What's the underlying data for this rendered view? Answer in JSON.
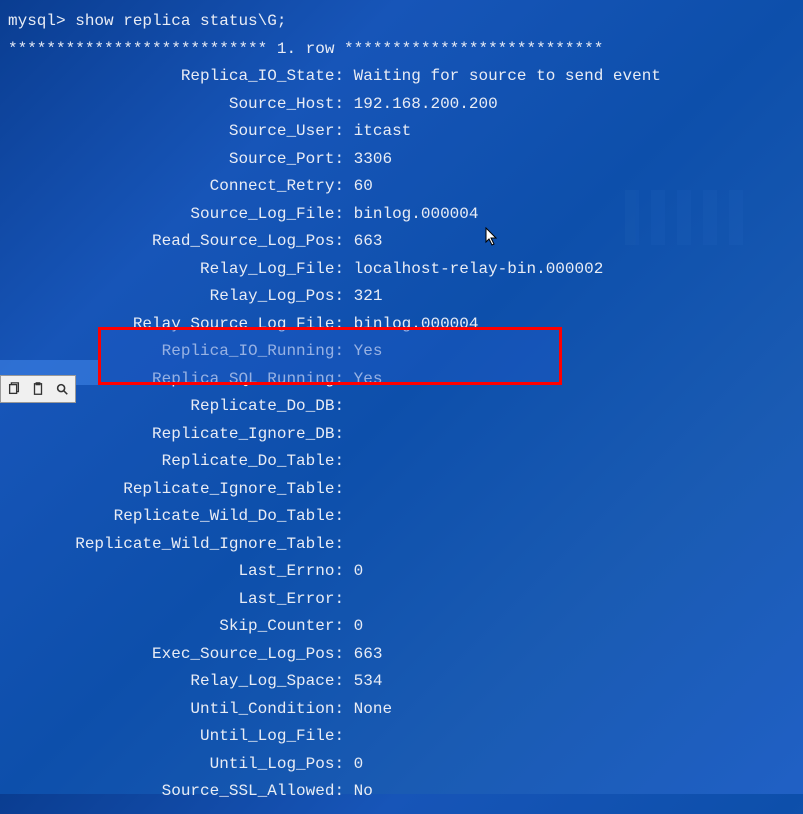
{
  "prompt": "mysql> ",
  "command": "show replica status\\G;",
  "row_separator": "*************************** 1. row ***************************",
  "fields": [
    {
      "label": "Replica_IO_State",
      "value": "Waiting for source to send event"
    },
    {
      "label": "Source_Host",
      "value": "192.168.200.200"
    },
    {
      "label": "Source_User",
      "value": "itcast"
    },
    {
      "label": "Source_Port",
      "value": "3306"
    },
    {
      "label": "Connect_Retry",
      "value": "60"
    },
    {
      "label": "Source_Log_File",
      "value": "binlog.000004"
    },
    {
      "label": "Read_Source_Log_Pos",
      "value": "663"
    },
    {
      "label": "Relay_Log_File",
      "value": "localhost-relay-bin.000002"
    },
    {
      "label": "Relay_Log_Pos",
      "value": "321"
    },
    {
      "label": "Relay_Source_Log_File",
      "value": "binlog.000004"
    },
    {
      "label": "Replica_IO_Running",
      "value": "Yes"
    },
    {
      "label": "Replica_SQL_Running",
      "value": "Yes"
    },
    {
      "label": "Replicate_Do_DB",
      "value": ""
    },
    {
      "label": "Replicate_Ignore_DB",
      "value": ""
    },
    {
      "label": "Replicate_Do_Table",
      "value": ""
    },
    {
      "label": "Replicate_Ignore_Table",
      "value": ""
    },
    {
      "label": "Replicate_Wild_Do_Table",
      "value": ""
    },
    {
      "label": "Replicate_Wild_Ignore_Table",
      "value": ""
    },
    {
      "label": "Last_Errno",
      "value": "0"
    },
    {
      "label": "Last_Error",
      "value": ""
    },
    {
      "label": "Skip_Counter",
      "value": "0"
    },
    {
      "label": "Exec_Source_Log_Pos",
      "value": "663"
    },
    {
      "label": "Relay_Log_Space",
      "value": "534"
    },
    {
      "label": "Until_Condition",
      "value": "None"
    },
    {
      "label": "Until_Log_File",
      "value": ""
    },
    {
      "label": "Until_Log_Pos",
      "value": "0"
    },
    {
      "label": "Source_SSL_Allowed",
      "value": "No"
    }
  ],
  "label_width": 34,
  "highlighted_rows": [
    10,
    11
  ]
}
